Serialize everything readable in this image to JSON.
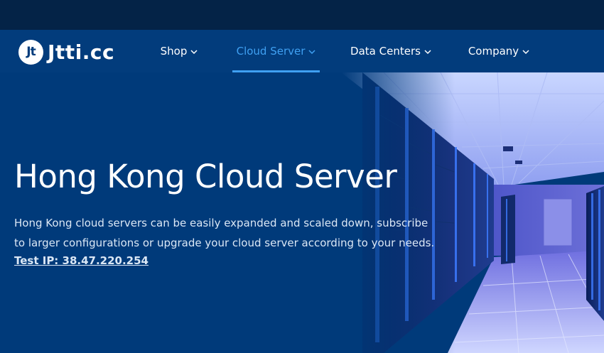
{
  "brand": {
    "logo_mark": "Jt",
    "name": "Jtti.cc"
  },
  "nav": {
    "items": [
      {
        "label": "Shop",
        "active": false
      },
      {
        "label": "Cloud Server",
        "active": true
      },
      {
        "label": "Data Centers",
        "active": false
      },
      {
        "label": "Company",
        "active": false
      }
    ],
    "chevron_icon": "chevron-down-icon"
  },
  "hero": {
    "title": "Hong Kong Cloud Server",
    "description": "Hong Kong cloud servers can be easily expanded and scaled down, subscribe to larger configurations or upgrade your cloud server according to your needs.",
    "link": "Test IP: 38.47.220.254",
    "image": "server-room-image"
  },
  "colors": {
    "topbar": "#042347",
    "navbar": "#023c7c",
    "hero_bg": "#003a7a",
    "accent": "#3fa0f2",
    "text": "#ffffff"
  }
}
